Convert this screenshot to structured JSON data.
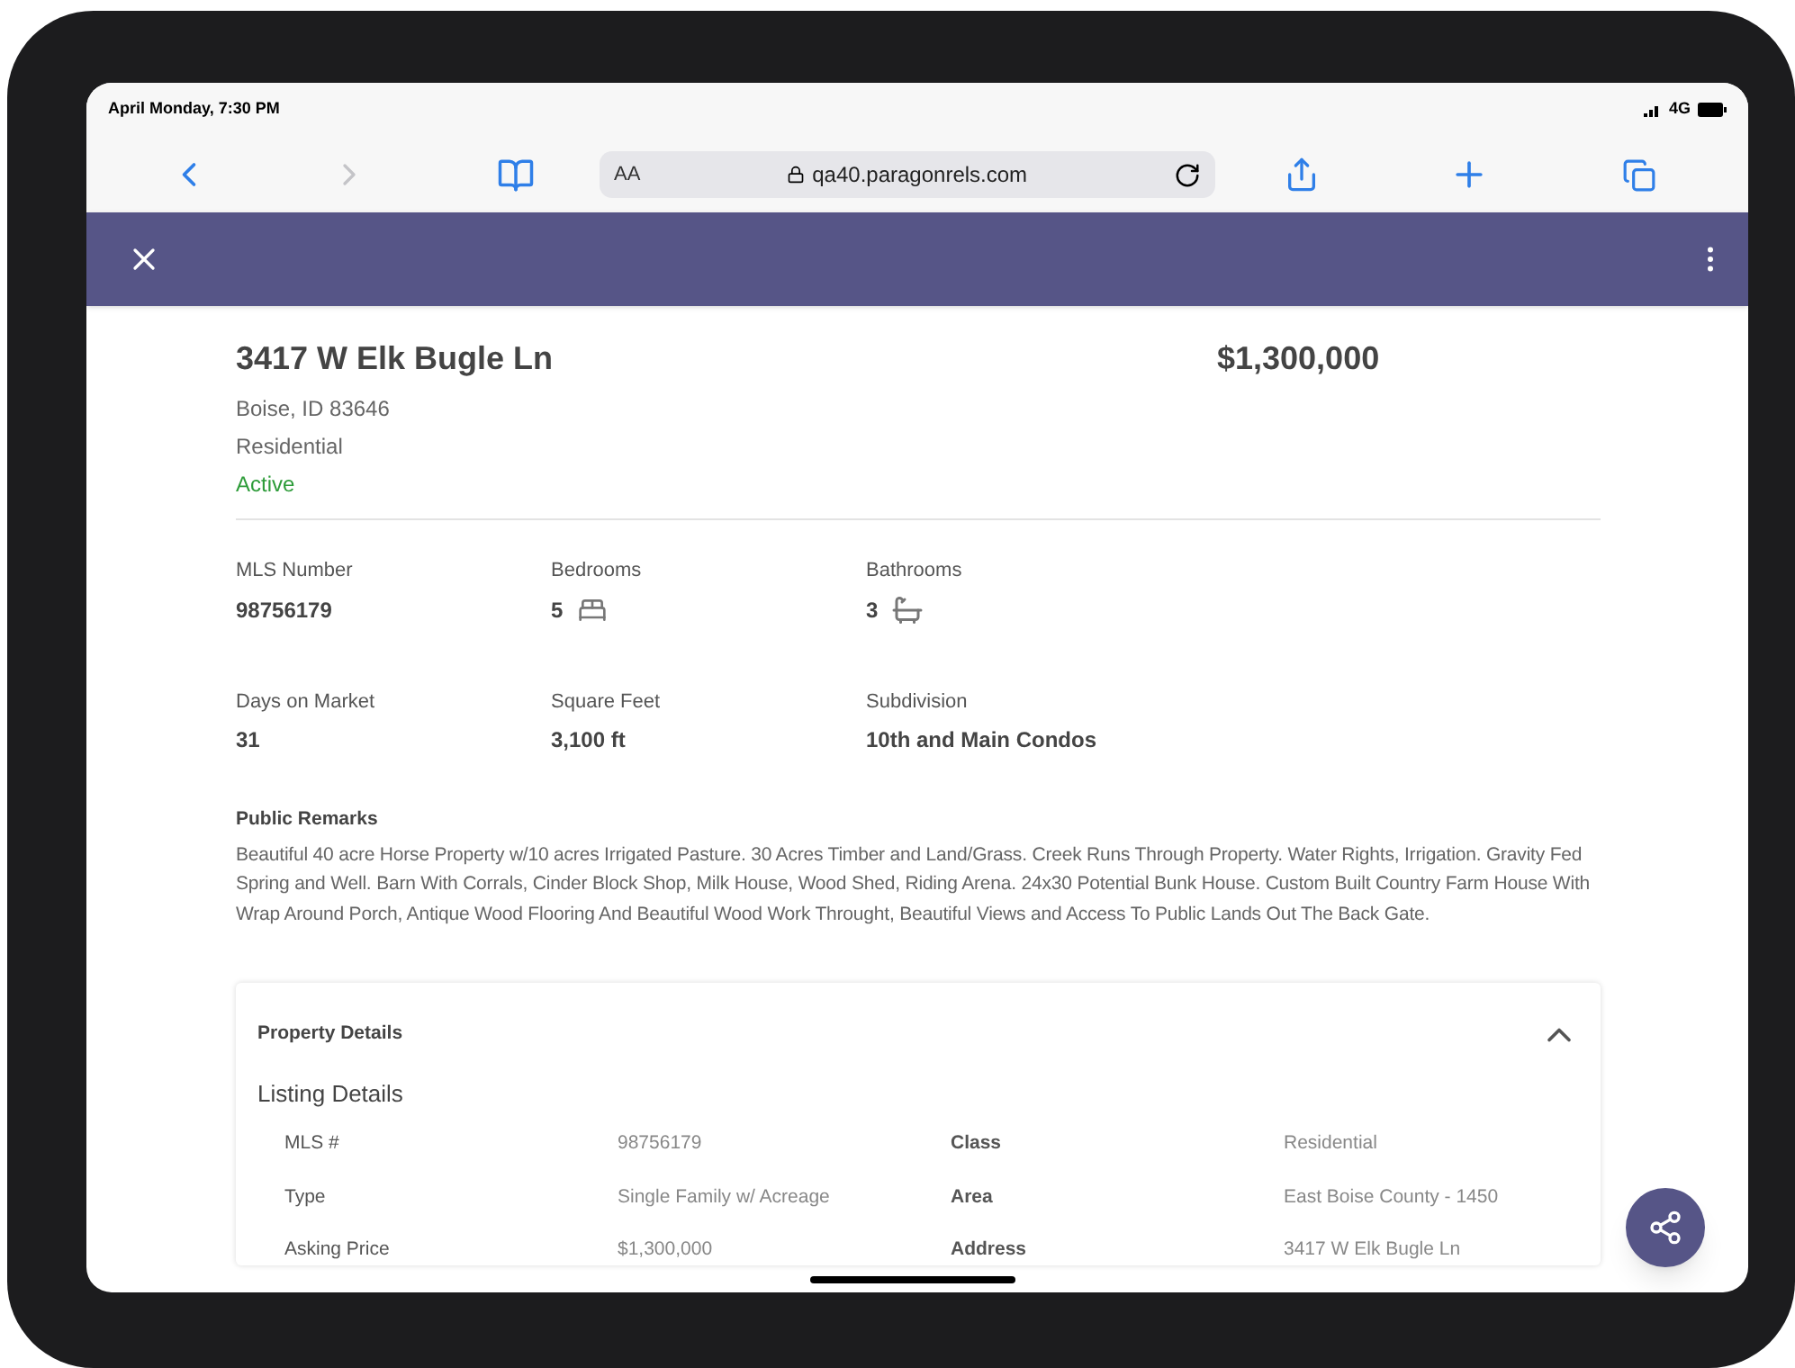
{
  "status_bar": {
    "time": "April Monday, 7:30 PM",
    "network": "4G"
  },
  "browser": {
    "text_size": "AA",
    "url": "qa40.paragonrels.com",
    "forward_disabled": true
  },
  "listing": {
    "address": "3417 W Elk Bugle Ln",
    "price": "$1,300,000",
    "city": "Boise, ID 83646",
    "type": "Residential",
    "status": "Active",
    "facts": [
      {
        "label": "MLS Number",
        "value": "98756179"
      },
      {
        "label": "Bedrooms",
        "value": "5",
        "kind": "bed"
      },
      {
        "label": "Bathrooms",
        "value": "3",
        "kind": "bath"
      },
      {
        "label": "Days on Market",
        "value": "31"
      },
      {
        "label": "Square Feet",
        "value": "3,100 ft"
      },
      {
        "label": "Subdivision",
        "value": "10th and Main Condos"
      }
    ],
    "remarks_title": "Public Remarks",
    "remarks": "Beautiful 40 acre Horse Property w/10 acres Irrigated Pasture. 30 Acres Timber and Land/Grass. Creek Runs Through Property. Water Rights, Irrigation. Gravity Fed Spring and Well. Barn With Corrals, Cinder Block Shop, Milk House, Wood Shed, Riding Arena. 24x30 Potential Bunk House. Custom Built Country Farm House With Wrap Around Porch, Antique Wood Flooring And Beautiful Wood Work Throught, Beautiful Views and Access To Public Lands Out The Back Gate."
  },
  "details": {
    "title": "Property Details",
    "expanded": true,
    "section": "Listing Details",
    "rows": [
      {
        "label": "MLS #",
        "value": "98756179",
        "label_2": "Class",
        "value_2": "Residential"
      },
      {
        "label": "Type",
        "value": "Single Family w/ Acreage",
        "label_2": "Area",
        "value_2": "East Boise County - 1450"
      },
      {
        "label": "Asking Price",
        "value": "$1,300,000",
        "label_2": "Address",
        "value_2": "3417 W Elk Bugle Ln"
      }
    ]
  }
}
